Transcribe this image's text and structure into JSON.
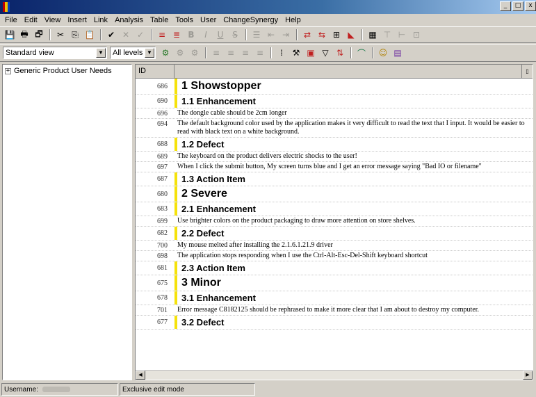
{
  "window": {
    "close_label": "x",
    "min_label": "_",
    "max_label": "□"
  },
  "menu": [
    "File",
    "Edit",
    "View",
    "Insert",
    "Link",
    "Analysis",
    "Table",
    "Tools",
    "User",
    "ChangeSynergy",
    "Help"
  ],
  "toolbar2": {
    "view_select": "Standard view",
    "level_select": "All levels"
  },
  "tree": {
    "root_label": "Generic Product User Needs"
  },
  "grid": {
    "id_header": "ID",
    "rows": [
      {
        "id": "686",
        "text": "1 Showstopper",
        "kind": "h1"
      },
      {
        "id": "690",
        "text": "1.1 Enhancement",
        "kind": "h2"
      },
      {
        "id": "696",
        "text": "The dongle cable should be 2cm longer",
        "kind": "item"
      },
      {
        "id": "694",
        "text": "The default background color used by the application makes it very difficult to read the text that I input. It would be easier to read with black text on a white background.",
        "kind": "item"
      },
      {
        "id": "688",
        "text": "1.2 Defect",
        "kind": "h2"
      },
      {
        "id": "689",
        "text": "The keyboard on the product delivers electric shocks to the user!",
        "kind": "item"
      },
      {
        "id": "697",
        "text": "When I click the submit button, My screen turns blue and I get an error message saying \"Bad IO or filename\"",
        "kind": "item"
      },
      {
        "id": "687",
        "text": "1.3 Action Item",
        "kind": "h2"
      },
      {
        "id": "680",
        "text": "2 Severe",
        "kind": "h1"
      },
      {
        "id": "683",
        "text": "2.1 Enhancement",
        "kind": "h2"
      },
      {
        "id": "699",
        "text": "Use brighter colors on the product packaging to draw more attention on store shelves.",
        "kind": "item"
      },
      {
        "id": "682",
        "text": "2.2 Defect",
        "kind": "h2"
      },
      {
        "id": "700",
        "text": "My mouse melted after installing the 2.1.6.1.21.9 driver",
        "kind": "item"
      },
      {
        "id": "698",
        "text": "The application stops responding when I use the Ctrl-Alt-Esc-Del-Shift keyboard shortcut",
        "kind": "item"
      },
      {
        "id": "681",
        "text": "2.3 Action Item",
        "kind": "h2"
      },
      {
        "id": "675",
        "text": "3 Minor",
        "kind": "h1"
      },
      {
        "id": "678",
        "text": "3.1 Enhancement",
        "kind": "h2"
      },
      {
        "id": "701",
        "text": "Error message C8182125 should be rephrased to make it more clear that I am about to destroy my computer.",
        "kind": "item"
      },
      {
        "id": "677",
        "text": "3.2 Defect",
        "kind": "h2"
      }
    ]
  },
  "status": {
    "username_label": "Username:",
    "mode": "Exclusive edit mode"
  },
  "colors": {
    "heading_bar": "#f5e20b",
    "titlebar_start": "#0a246a"
  }
}
